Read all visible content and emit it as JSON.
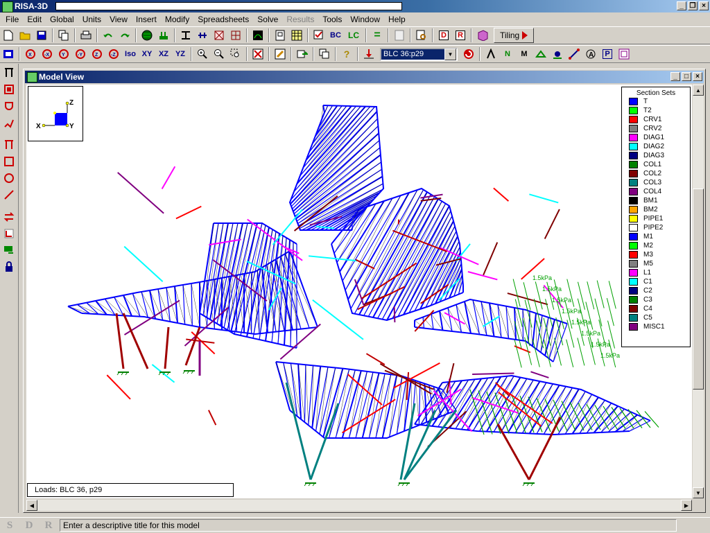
{
  "app": {
    "title": "RISA-3D",
    "model_title_field": ""
  },
  "menu": [
    "File",
    "Edit",
    "Global",
    "Units",
    "View",
    "Insert",
    "Modify",
    "Spreadsheets",
    "Solve",
    "Results",
    "Tools",
    "Window",
    "Help"
  ],
  "menu_disabled": "Results",
  "toolbar1": {
    "bc_label": "BC",
    "lc_label": "LC",
    "tiling_label": "Tiling"
  },
  "toolbar2": {
    "iso_label": "Iso",
    "xy_label": "XY",
    "xz_label": "XZ",
    "yz_label": "YZ",
    "load_combo_value": "BLC 36:p29"
  },
  "model_view": {
    "title": "Model View",
    "axes": {
      "z": "Z",
      "x": "X",
      "y": "Y"
    },
    "loads_label": "Loads: BLC 36, p29"
  },
  "legend": {
    "title": "Section Sets",
    "items": [
      {
        "name": "T",
        "color": "#0000ff"
      },
      {
        "name": "T2",
        "color": "#00ff00"
      },
      {
        "name": "CRV1",
        "color": "#ff0000"
      },
      {
        "name": "CRV2",
        "color": "#808080"
      },
      {
        "name": "DIAG1",
        "color": "#ff00ff"
      },
      {
        "name": "DIAG2",
        "color": "#00ffff"
      },
      {
        "name": "DIAG3",
        "color": "#000080"
      },
      {
        "name": "COL1",
        "color": "#008000"
      },
      {
        "name": "COL2",
        "color": "#800000"
      },
      {
        "name": "COL3",
        "color": "#008080"
      },
      {
        "name": "COL4",
        "color": "#800080"
      },
      {
        "name": "BM1",
        "color": "#000000"
      },
      {
        "name": "BM2",
        "color": "#ffa500"
      },
      {
        "name": "PIPE1",
        "color": "#ffff00"
      },
      {
        "name": "PIPE2",
        "color": "#ffffff"
      },
      {
        "name": "M1",
        "color": "#0000ff"
      },
      {
        "name": "M2",
        "color": "#00ff00"
      },
      {
        "name": "M3",
        "color": "#ff0000"
      },
      {
        "name": "M5",
        "color": "#808080"
      },
      {
        "name": "L1",
        "color": "#ff00ff"
      },
      {
        "name": "C1",
        "color": "#00ffff"
      },
      {
        "name": "C2",
        "color": "#000080"
      },
      {
        "name": "C3",
        "color": "#008000"
      },
      {
        "name": "C4",
        "color": "#800000"
      },
      {
        "name": "C5",
        "color": "#008080"
      },
      {
        "name": "MISC1",
        "color": "#800080"
      }
    ]
  },
  "status": {
    "s": "S",
    "d": "D",
    "r": "R",
    "message": "Enter a descriptive title for this model"
  },
  "load_label": "1.5kPa"
}
